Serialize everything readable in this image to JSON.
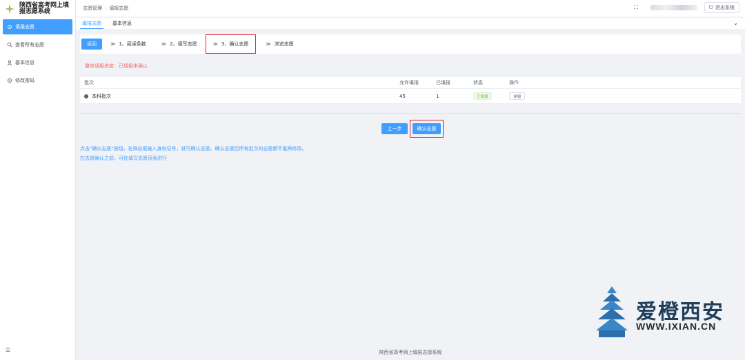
{
  "app": {
    "title": "陕西省高考网上填报志愿系统"
  },
  "sidebar": {
    "items": [
      {
        "label": "填报志愿",
        "icon": "gear-icon",
        "active": true
      },
      {
        "label": "查看所有志愿",
        "icon": "search-icon",
        "active": false
      },
      {
        "label": "基本信息",
        "icon": "user-icon",
        "active": false
      },
      {
        "label": "修改密码",
        "icon": "gear-icon",
        "active": false
      }
    ]
  },
  "header": {
    "breadcrumb": [
      "志愿管理",
      "填报志愿"
    ],
    "breadcrumb_sep": "/",
    "logout_label": "退出系统"
  },
  "tabs": [
    {
      "label": "填报志愿",
      "active": true
    },
    {
      "label": "基本信息",
      "active": false
    }
  ],
  "steps": {
    "back_label": "返回",
    "items": [
      {
        "label": "1、阅读条款"
      },
      {
        "label": "2、填写志愿"
      },
      {
        "label": "3、确认志愿",
        "current": true
      },
      {
        "label": "浏览志愿"
      }
    ]
  },
  "progress_text": "整体填报进度：已填报未确认",
  "table": {
    "headers": [
      "批次",
      "允许填报",
      "已填报",
      "状态",
      "操作"
    ],
    "rows": [
      {
        "batch": "本科批次",
        "allowed": "45",
        "filled": "1",
        "status": "已填报",
        "action": "详细"
      }
    ]
  },
  "actions": {
    "prev_label": "上一步",
    "confirm_label": "确认志愿"
  },
  "notes": [
    "点击\"确认志愿\"按钮，在弹出框输入身份证号，就可确认志愿。确认志愿后所有批次的志愿都不能再修改。",
    "在志愿确认之前，可在填写志愿页面进行"
  ],
  "watermark": {
    "name": "爱橙西安",
    "url": "WWW.IXIAN.CN"
  },
  "footer": "陕西省高考网上填报志愿系统",
  "colors": {
    "primary": "#409eff",
    "danger": "#f56c6c",
    "success": "#67c23a",
    "highlight_border": "#e02020"
  }
}
